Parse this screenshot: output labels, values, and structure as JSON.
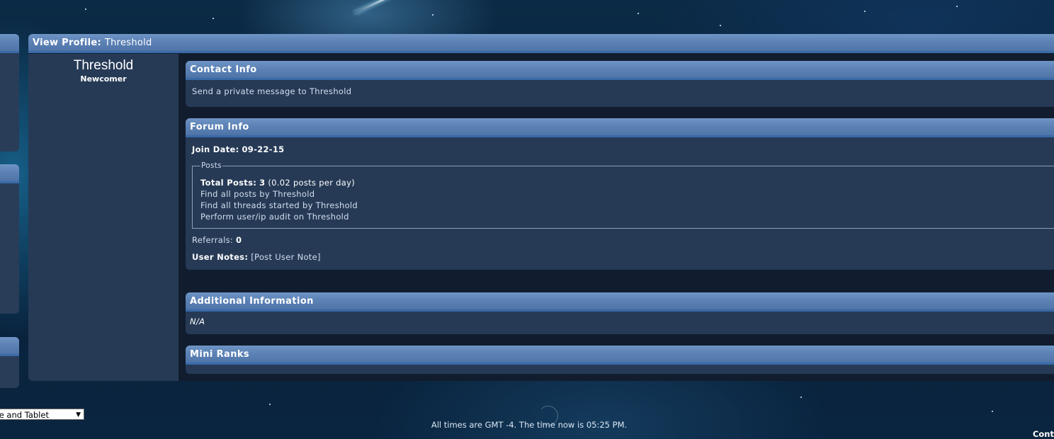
{
  "profile": {
    "header_label": "View Profile",
    "header_name": "Threshold",
    "username": "Threshold",
    "user_title": "Newcomer"
  },
  "contact": {
    "title": "Contact Info",
    "pm_link": "Send a private message to Threshold"
  },
  "forum_info": {
    "title": "Forum Info",
    "join_label": "Join Date:",
    "join_value": "09-22-15",
    "posts_legend": "Posts",
    "total_posts_label": "Total Posts:",
    "total_posts_value": "3",
    "posts_per_day": "(0.02 posts per day)",
    "find_posts": "Find all posts by Threshold",
    "find_threads": "Find all threads started by Threshold",
    "audit": "Perform user/ip audit on Threshold",
    "referrals_label": "Referrals:",
    "referrals_value": "0",
    "user_notes_label": "User Notes:",
    "post_user_note": "[Post User Note]"
  },
  "additional": {
    "title": "Additional Information",
    "value": "N/A"
  },
  "mini_ranks": {
    "title": "Mini Ranks"
  },
  "footer": {
    "style_select": "bile and Tablet",
    "time_prefix": "All times are GMT -4. The time now is ",
    "time_value": "05:25 PM",
    "time_suffix": ".",
    "corner_text": "Cont"
  }
}
